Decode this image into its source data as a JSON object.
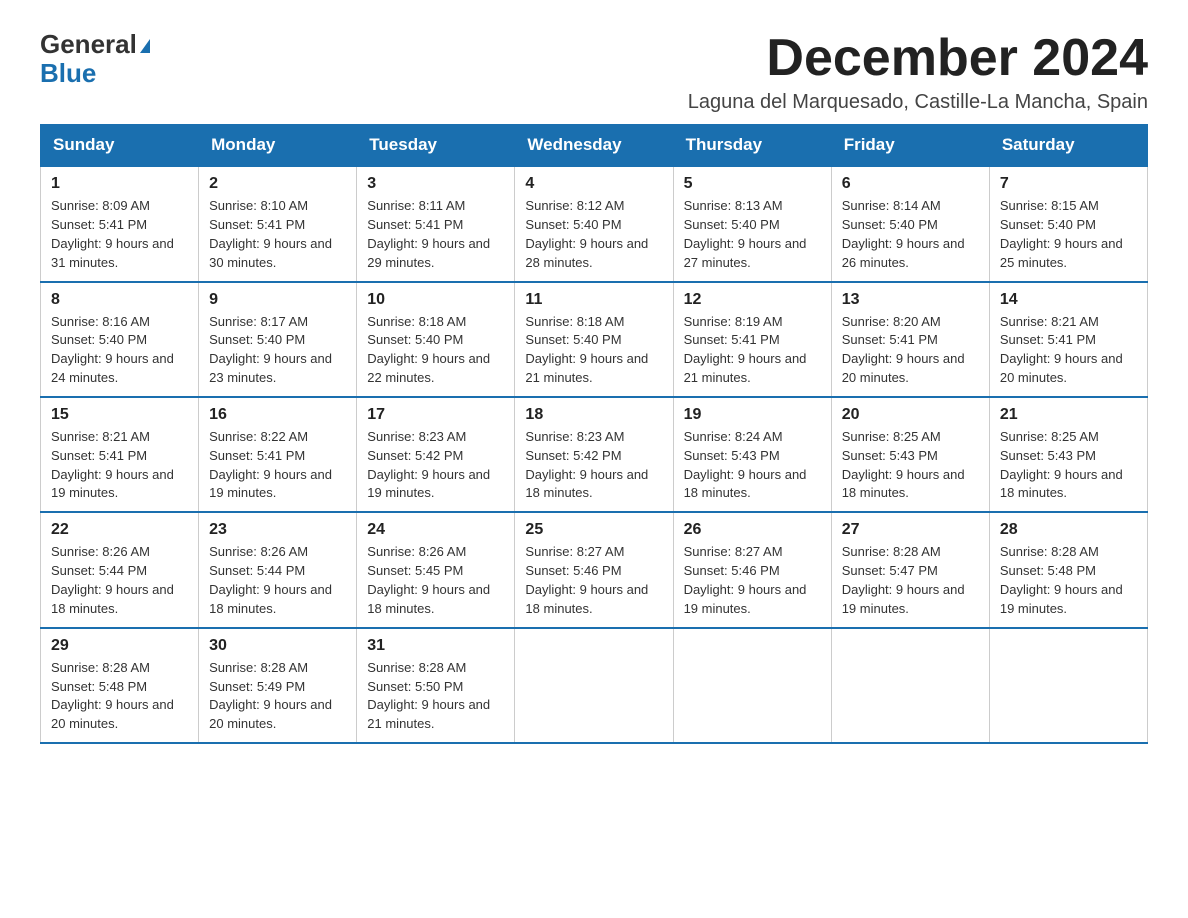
{
  "logo": {
    "line1": "General",
    "line2": "Blue"
  },
  "title": "December 2024",
  "location": "Laguna del Marquesado, Castille-La Mancha, Spain",
  "days_of_week": [
    "Sunday",
    "Monday",
    "Tuesday",
    "Wednesday",
    "Thursday",
    "Friday",
    "Saturday"
  ],
  "weeks": [
    [
      {
        "day": "1",
        "sunrise": "8:09 AM",
        "sunset": "5:41 PM",
        "daylight": "9 hours and 31 minutes."
      },
      {
        "day": "2",
        "sunrise": "8:10 AM",
        "sunset": "5:41 PM",
        "daylight": "9 hours and 30 minutes."
      },
      {
        "day": "3",
        "sunrise": "8:11 AM",
        "sunset": "5:41 PM",
        "daylight": "9 hours and 29 minutes."
      },
      {
        "day": "4",
        "sunrise": "8:12 AM",
        "sunset": "5:40 PM",
        "daylight": "9 hours and 28 minutes."
      },
      {
        "day": "5",
        "sunrise": "8:13 AM",
        "sunset": "5:40 PM",
        "daylight": "9 hours and 27 minutes."
      },
      {
        "day": "6",
        "sunrise": "8:14 AM",
        "sunset": "5:40 PM",
        "daylight": "9 hours and 26 minutes."
      },
      {
        "day": "7",
        "sunrise": "8:15 AM",
        "sunset": "5:40 PM",
        "daylight": "9 hours and 25 minutes."
      }
    ],
    [
      {
        "day": "8",
        "sunrise": "8:16 AM",
        "sunset": "5:40 PM",
        "daylight": "9 hours and 24 minutes."
      },
      {
        "day": "9",
        "sunrise": "8:17 AM",
        "sunset": "5:40 PM",
        "daylight": "9 hours and 23 minutes."
      },
      {
        "day": "10",
        "sunrise": "8:18 AM",
        "sunset": "5:40 PM",
        "daylight": "9 hours and 22 minutes."
      },
      {
        "day": "11",
        "sunrise": "8:18 AM",
        "sunset": "5:40 PM",
        "daylight": "9 hours and 21 minutes."
      },
      {
        "day": "12",
        "sunrise": "8:19 AM",
        "sunset": "5:41 PM",
        "daylight": "9 hours and 21 minutes."
      },
      {
        "day": "13",
        "sunrise": "8:20 AM",
        "sunset": "5:41 PM",
        "daylight": "9 hours and 20 minutes."
      },
      {
        "day": "14",
        "sunrise": "8:21 AM",
        "sunset": "5:41 PM",
        "daylight": "9 hours and 20 minutes."
      }
    ],
    [
      {
        "day": "15",
        "sunrise": "8:21 AM",
        "sunset": "5:41 PM",
        "daylight": "9 hours and 19 minutes."
      },
      {
        "day": "16",
        "sunrise": "8:22 AM",
        "sunset": "5:41 PM",
        "daylight": "9 hours and 19 minutes."
      },
      {
        "day": "17",
        "sunrise": "8:23 AM",
        "sunset": "5:42 PM",
        "daylight": "9 hours and 19 minutes."
      },
      {
        "day": "18",
        "sunrise": "8:23 AM",
        "sunset": "5:42 PM",
        "daylight": "9 hours and 18 minutes."
      },
      {
        "day": "19",
        "sunrise": "8:24 AM",
        "sunset": "5:43 PM",
        "daylight": "9 hours and 18 minutes."
      },
      {
        "day": "20",
        "sunrise": "8:25 AM",
        "sunset": "5:43 PM",
        "daylight": "9 hours and 18 minutes."
      },
      {
        "day": "21",
        "sunrise": "8:25 AM",
        "sunset": "5:43 PM",
        "daylight": "9 hours and 18 minutes."
      }
    ],
    [
      {
        "day": "22",
        "sunrise": "8:26 AM",
        "sunset": "5:44 PM",
        "daylight": "9 hours and 18 minutes."
      },
      {
        "day": "23",
        "sunrise": "8:26 AM",
        "sunset": "5:44 PM",
        "daylight": "9 hours and 18 minutes."
      },
      {
        "day": "24",
        "sunrise": "8:26 AM",
        "sunset": "5:45 PM",
        "daylight": "9 hours and 18 minutes."
      },
      {
        "day": "25",
        "sunrise": "8:27 AM",
        "sunset": "5:46 PM",
        "daylight": "9 hours and 18 minutes."
      },
      {
        "day": "26",
        "sunrise": "8:27 AM",
        "sunset": "5:46 PM",
        "daylight": "9 hours and 19 minutes."
      },
      {
        "day": "27",
        "sunrise": "8:28 AM",
        "sunset": "5:47 PM",
        "daylight": "9 hours and 19 minutes."
      },
      {
        "day": "28",
        "sunrise": "8:28 AM",
        "sunset": "5:48 PM",
        "daylight": "9 hours and 19 minutes."
      }
    ],
    [
      {
        "day": "29",
        "sunrise": "8:28 AM",
        "sunset": "5:48 PM",
        "daylight": "9 hours and 20 minutes."
      },
      {
        "day": "30",
        "sunrise": "8:28 AM",
        "sunset": "5:49 PM",
        "daylight": "9 hours and 20 minutes."
      },
      {
        "day": "31",
        "sunrise": "8:28 AM",
        "sunset": "5:50 PM",
        "daylight": "9 hours and 21 minutes."
      },
      null,
      null,
      null,
      null
    ]
  ]
}
